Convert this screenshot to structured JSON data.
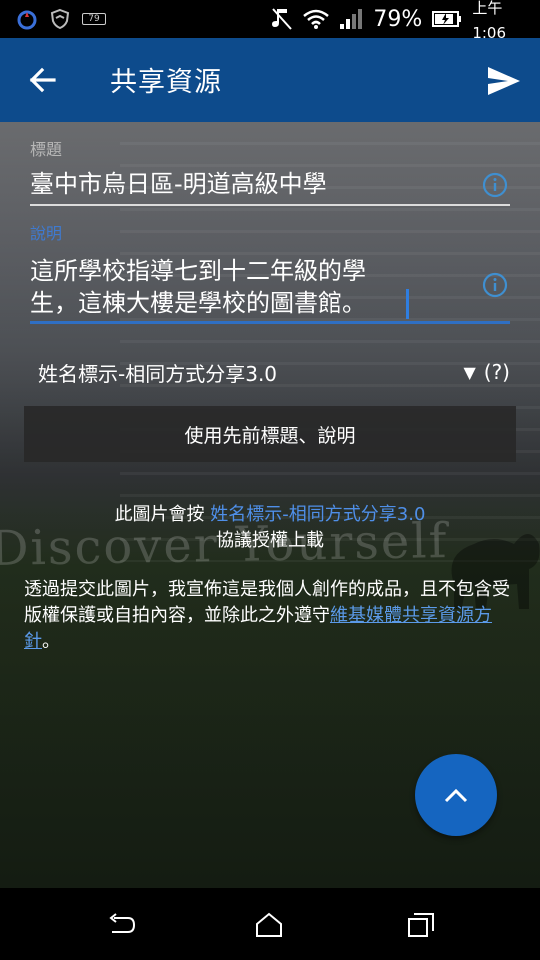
{
  "status_bar": {
    "notification_badge": "79",
    "battery_percent": "79%",
    "time": "上午1:06"
  },
  "app_bar": {
    "title": "共享資源"
  },
  "form": {
    "title_label": "標題",
    "title_value": "臺中市烏日區-明道高級中學",
    "description_label": "說明",
    "description_value_line1": "這所學校指導七到十二年級的學",
    "description_value_line2": "生，這棟大樓是學校的圖書館。",
    "license_selected": "姓名標示-相同方式分享3.0",
    "license_help": "(?)",
    "use_previous_button": "使用先前標題、說明"
  },
  "license_note": {
    "prefix": "此圖片會按 ",
    "link": "姓名標示-相同方式分享3.0",
    "suffix": "協議授權上載"
  },
  "terms": {
    "text": "透過提交此圖片，我宣佈這是我個人創作的成品，且不包含受版權保護或自拍內容，並除此之外遵守",
    "link": "維基媒體共享資源方針",
    "end": "。"
  },
  "background_photo_text": "Discover Yourself",
  "colors": {
    "app_bar": "#0d4b8c",
    "accent": "#1565c0",
    "link": "#4f8fe8"
  }
}
